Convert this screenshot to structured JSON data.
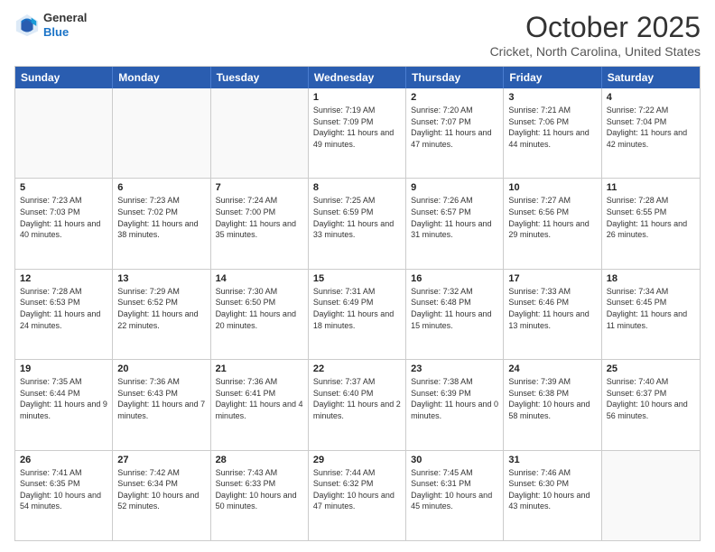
{
  "header": {
    "logo_general": "General",
    "logo_blue": "Blue",
    "month_title": "October 2025",
    "location": "Cricket, North Carolina, United States"
  },
  "days_of_week": [
    "Sunday",
    "Monday",
    "Tuesday",
    "Wednesday",
    "Thursday",
    "Friday",
    "Saturday"
  ],
  "weeks": [
    [
      {
        "day": "",
        "info": ""
      },
      {
        "day": "",
        "info": ""
      },
      {
        "day": "",
        "info": ""
      },
      {
        "day": "1",
        "info": "Sunrise: 7:19 AM\nSunset: 7:09 PM\nDaylight: 11 hours and 49 minutes."
      },
      {
        "day": "2",
        "info": "Sunrise: 7:20 AM\nSunset: 7:07 PM\nDaylight: 11 hours and 47 minutes."
      },
      {
        "day": "3",
        "info": "Sunrise: 7:21 AM\nSunset: 7:06 PM\nDaylight: 11 hours and 44 minutes."
      },
      {
        "day": "4",
        "info": "Sunrise: 7:22 AM\nSunset: 7:04 PM\nDaylight: 11 hours and 42 minutes."
      }
    ],
    [
      {
        "day": "5",
        "info": "Sunrise: 7:23 AM\nSunset: 7:03 PM\nDaylight: 11 hours and 40 minutes."
      },
      {
        "day": "6",
        "info": "Sunrise: 7:23 AM\nSunset: 7:02 PM\nDaylight: 11 hours and 38 minutes."
      },
      {
        "day": "7",
        "info": "Sunrise: 7:24 AM\nSunset: 7:00 PM\nDaylight: 11 hours and 35 minutes."
      },
      {
        "day": "8",
        "info": "Sunrise: 7:25 AM\nSunset: 6:59 PM\nDaylight: 11 hours and 33 minutes."
      },
      {
        "day": "9",
        "info": "Sunrise: 7:26 AM\nSunset: 6:57 PM\nDaylight: 11 hours and 31 minutes."
      },
      {
        "day": "10",
        "info": "Sunrise: 7:27 AM\nSunset: 6:56 PM\nDaylight: 11 hours and 29 minutes."
      },
      {
        "day": "11",
        "info": "Sunrise: 7:28 AM\nSunset: 6:55 PM\nDaylight: 11 hours and 26 minutes."
      }
    ],
    [
      {
        "day": "12",
        "info": "Sunrise: 7:28 AM\nSunset: 6:53 PM\nDaylight: 11 hours and 24 minutes."
      },
      {
        "day": "13",
        "info": "Sunrise: 7:29 AM\nSunset: 6:52 PM\nDaylight: 11 hours and 22 minutes."
      },
      {
        "day": "14",
        "info": "Sunrise: 7:30 AM\nSunset: 6:50 PM\nDaylight: 11 hours and 20 minutes."
      },
      {
        "day": "15",
        "info": "Sunrise: 7:31 AM\nSunset: 6:49 PM\nDaylight: 11 hours and 18 minutes."
      },
      {
        "day": "16",
        "info": "Sunrise: 7:32 AM\nSunset: 6:48 PM\nDaylight: 11 hours and 15 minutes."
      },
      {
        "day": "17",
        "info": "Sunrise: 7:33 AM\nSunset: 6:46 PM\nDaylight: 11 hours and 13 minutes."
      },
      {
        "day": "18",
        "info": "Sunrise: 7:34 AM\nSunset: 6:45 PM\nDaylight: 11 hours and 11 minutes."
      }
    ],
    [
      {
        "day": "19",
        "info": "Sunrise: 7:35 AM\nSunset: 6:44 PM\nDaylight: 11 hours and 9 minutes."
      },
      {
        "day": "20",
        "info": "Sunrise: 7:36 AM\nSunset: 6:43 PM\nDaylight: 11 hours and 7 minutes."
      },
      {
        "day": "21",
        "info": "Sunrise: 7:36 AM\nSunset: 6:41 PM\nDaylight: 11 hours and 4 minutes."
      },
      {
        "day": "22",
        "info": "Sunrise: 7:37 AM\nSunset: 6:40 PM\nDaylight: 11 hours and 2 minutes."
      },
      {
        "day": "23",
        "info": "Sunrise: 7:38 AM\nSunset: 6:39 PM\nDaylight: 11 hours and 0 minutes."
      },
      {
        "day": "24",
        "info": "Sunrise: 7:39 AM\nSunset: 6:38 PM\nDaylight: 10 hours and 58 minutes."
      },
      {
        "day": "25",
        "info": "Sunrise: 7:40 AM\nSunset: 6:37 PM\nDaylight: 10 hours and 56 minutes."
      }
    ],
    [
      {
        "day": "26",
        "info": "Sunrise: 7:41 AM\nSunset: 6:35 PM\nDaylight: 10 hours and 54 minutes."
      },
      {
        "day": "27",
        "info": "Sunrise: 7:42 AM\nSunset: 6:34 PM\nDaylight: 10 hours and 52 minutes."
      },
      {
        "day": "28",
        "info": "Sunrise: 7:43 AM\nSunset: 6:33 PM\nDaylight: 10 hours and 50 minutes."
      },
      {
        "day": "29",
        "info": "Sunrise: 7:44 AM\nSunset: 6:32 PM\nDaylight: 10 hours and 47 minutes."
      },
      {
        "day": "30",
        "info": "Sunrise: 7:45 AM\nSunset: 6:31 PM\nDaylight: 10 hours and 45 minutes."
      },
      {
        "day": "31",
        "info": "Sunrise: 7:46 AM\nSunset: 6:30 PM\nDaylight: 10 hours and 43 minutes."
      },
      {
        "day": "",
        "info": ""
      }
    ]
  ]
}
